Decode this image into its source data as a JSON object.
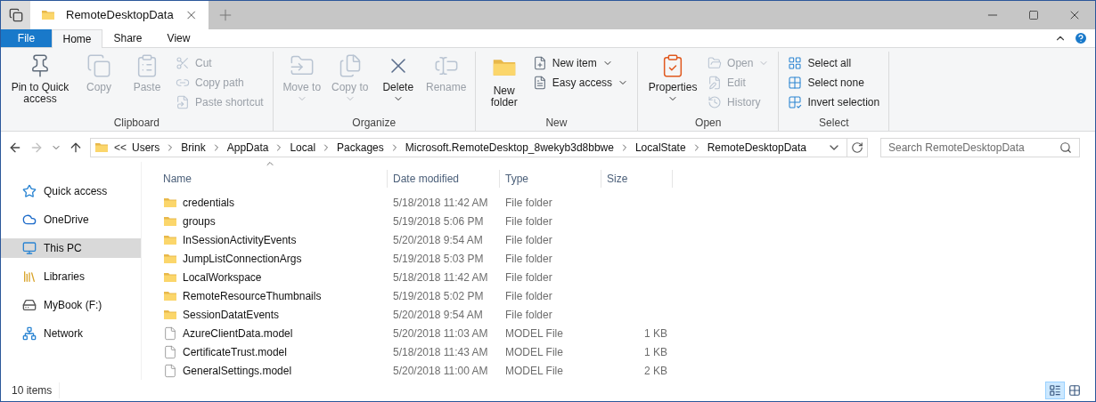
{
  "window": {
    "tab_title": "RemoteDesktopData"
  },
  "ribbon_tabs": [
    {
      "label": "File",
      "kind": "file",
      "selected": false
    },
    {
      "label": "Home",
      "kind": "tab",
      "selected": true
    },
    {
      "label": "Share",
      "kind": "tab",
      "selected": false
    },
    {
      "label": "View",
      "kind": "tab",
      "selected": false
    }
  ],
  "ribbon_groups": [
    {
      "label": "Clipboard",
      "items": [
        {
          "label": "Pin to Quick access",
          "kind": "large",
          "disabled": false,
          "dropdown": false
        },
        {
          "label": "Copy",
          "kind": "large",
          "disabled": true,
          "dropdown": false
        },
        {
          "label": "Paste",
          "kind": "large",
          "disabled": true,
          "dropdown": false
        },
        {
          "label": "Cut",
          "kind": "small",
          "disabled": true,
          "dropdown": false
        },
        {
          "label": "Copy path",
          "kind": "small",
          "disabled": true,
          "dropdown": false
        },
        {
          "label": "Paste shortcut",
          "kind": "small",
          "disabled": true,
          "dropdown": false
        }
      ]
    },
    {
      "label": "Organize",
      "items": [
        {
          "label": "Move to",
          "kind": "large",
          "disabled": true,
          "dropdown": true
        },
        {
          "label": "Copy to",
          "kind": "large",
          "disabled": true,
          "dropdown": true
        },
        {
          "label": "Delete",
          "kind": "large",
          "disabled": false,
          "dropdown": true
        },
        {
          "label": "Rename",
          "kind": "large",
          "disabled": true,
          "dropdown": false
        }
      ]
    },
    {
      "label": "New",
      "items": [
        {
          "label": "New folder",
          "kind": "large",
          "disabled": false,
          "dropdown": false
        },
        {
          "label": "New item",
          "kind": "small",
          "disabled": false,
          "dropdown": true
        },
        {
          "label": "Easy access",
          "kind": "small",
          "disabled": false,
          "dropdown": true
        }
      ]
    },
    {
      "label": "Open",
      "items": [
        {
          "label": "Properties",
          "kind": "large",
          "disabled": false,
          "dropdown": true
        },
        {
          "label": "Open",
          "kind": "small",
          "disabled": true,
          "dropdown": true
        },
        {
          "label": "Edit",
          "kind": "small",
          "disabled": true,
          "dropdown": false
        },
        {
          "label": "History",
          "kind": "small",
          "disabled": true,
          "dropdown": false
        }
      ]
    },
    {
      "label": "Select",
      "items": [
        {
          "label": "Select all",
          "kind": "small",
          "disabled": false,
          "dropdown": false
        },
        {
          "label": "Select none",
          "kind": "small",
          "disabled": false,
          "dropdown": false
        },
        {
          "label": "Invert selection",
          "kind": "small",
          "disabled": false,
          "dropdown": false
        }
      ]
    }
  ],
  "navigation": {
    "back_disabled": false,
    "forward_disabled": true
  },
  "address_bar": {
    "overflow": "<<",
    "segments": [
      "Users",
      "Brink",
      "AppData",
      "Local",
      "Packages",
      "Microsoft.RemoteDesktop_8wekyb3d8bbwe",
      "LocalState",
      "RemoteDesktopData"
    ]
  },
  "search": {
    "placeholder": "Search RemoteDesktopData"
  },
  "sidebar": {
    "items": [
      {
        "label": "Quick access",
        "selected": false
      },
      {
        "label": "OneDrive",
        "selected": false
      },
      {
        "label": "This PC",
        "selected": true
      },
      {
        "label": "Libraries",
        "selected": false
      },
      {
        "label": "MyBook (F:)",
        "selected": false
      },
      {
        "label": "Network",
        "selected": false
      }
    ]
  },
  "table": {
    "columns": [
      "Name",
      "Date modified",
      "Type",
      "Size"
    ],
    "rows": [
      {
        "kind": "folder",
        "name": "credentials",
        "date": "5/18/2018 11:42 AM",
        "type": "File folder"
      },
      {
        "kind": "folder",
        "name": "groups",
        "date": "5/19/2018 5:06 PM",
        "type": "File folder"
      },
      {
        "kind": "folder",
        "name": "InSessionActivityEvents",
        "date": "5/20/2018 9:54 AM",
        "type": "File folder"
      },
      {
        "kind": "folder",
        "name": "JumpListConnectionArgs",
        "date": "5/19/2018 5:03 PM",
        "type": "File folder"
      },
      {
        "kind": "folder",
        "name": "LocalWorkspace",
        "date": "5/18/2018 11:42 AM",
        "type": "File folder"
      },
      {
        "kind": "folder",
        "name": "RemoteResourceThumbnails",
        "date": "5/19/2018 5:02 PM",
        "type": "File folder"
      },
      {
        "kind": "folder",
        "name": "SessionDatatEvents",
        "date": "5/20/2018 9:54 AM",
        "type": "File folder"
      },
      {
        "kind": "file",
        "name": "AzureClientData.model",
        "date": "5/20/2018 11:03 AM",
        "type": "MODEL File",
        "size": "1 KB"
      },
      {
        "kind": "file",
        "name": "CertificateTrust.model",
        "date": "5/18/2018 11:43 AM",
        "type": "MODEL File",
        "size": "1 KB"
      },
      {
        "kind": "file",
        "name": "GeneralSettings.model",
        "date": "5/20/2018 11:00 AM",
        "type": "MODEL File",
        "size": "2 KB"
      }
    ]
  },
  "status_bar": {
    "item_count": "10 items",
    "views": [
      {
        "kind": "details",
        "selected": true
      },
      {
        "kind": "large_icons",
        "selected": false
      }
    ]
  }
}
